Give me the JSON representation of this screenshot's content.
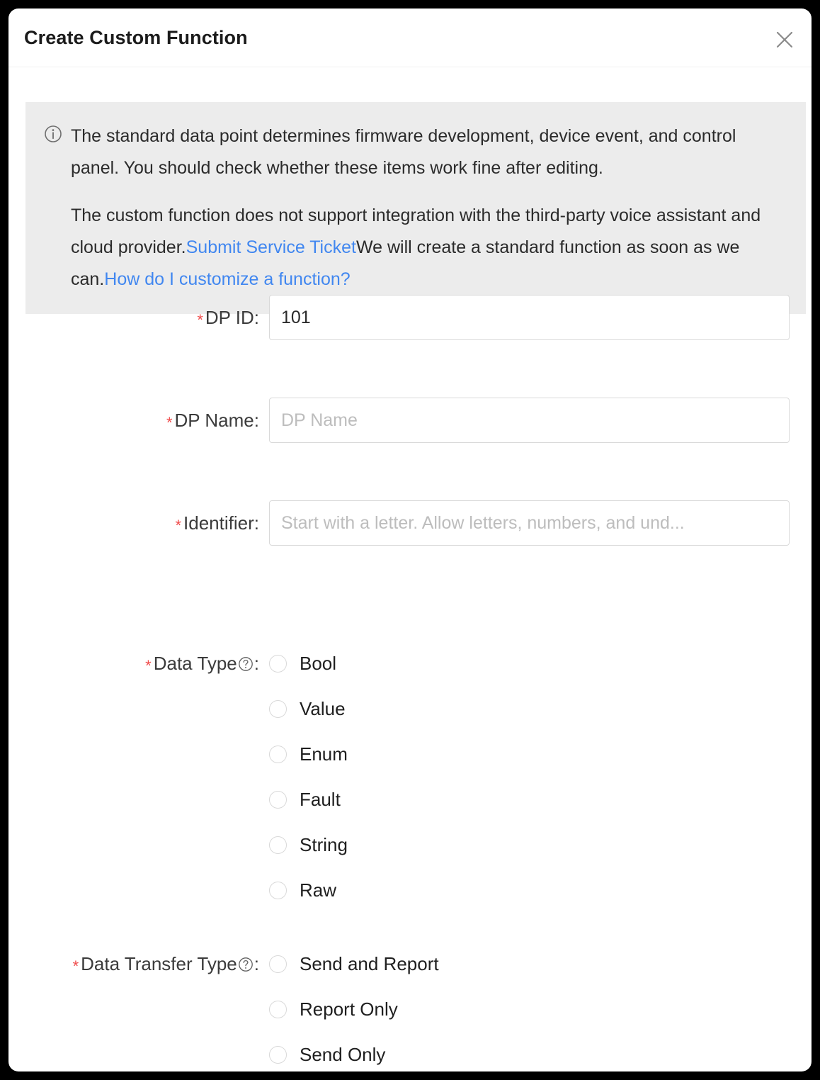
{
  "dialog": {
    "title": "Create Custom Function",
    "close_icon": "close-icon"
  },
  "info_banner": {
    "icon": "info-circle-icon",
    "paragraph_1": "The standard data point determines firmware development, device event, and control panel. You should check whether these items work fine after editing.",
    "paragraph_2_part_1": "The custom function does not support integration with the third-party voice assistant and cloud provider.",
    "link_1": "Submit Service Ticket",
    "paragraph_2_part_2": "We will create a standard function as soon as we can.",
    "link_2": "How do I customize a function?",
    "link_color": "#4187f0",
    "background_color": "#ececec"
  },
  "form": {
    "required_marker": "*",
    "help_icon": "question-circle-icon",
    "dp_id": {
      "label": "DP ID",
      "colon": ":",
      "value": "101",
      "placeholder": ""
    },
    "dp_name": {
      "label": "DP Name",
      "colon": ":",
      "value": "",
      "placeholder": "DP Name"
    },
    "identifier": {
      "label": "Identifier",
      "colon": ":",
      "value": "",
      "placeholder": "Start with a letter. Allow letters, numbers, and und..."
    },
    "data_type": {
      "label": "Data Type",
      "colon": ":",
      "selected": "",
      "options": [
        {
          "label": "Bool",
          "checked": false
        },
        {
          "label": "Value",
          "checked": false
        },
        {
          "label": "Enum",
          "checked": false
        },
        {
          "label": "Fault",
          "checked": false
        },
        {
          "label": "String",
          "checked": false
        },
        {
          "label": "Raw",
          "checked": false
        }
      ]
    },
    "data_transfer_type": {
      "label": "Data Transfer Type",
      "colon": ":",
      "selected": "",
      "options": [
        {
          "label": "Send and Report",
          "checked": false
        },
        {
          "label": "Report Only",
          "checked": false
        },
        {
          "label": "Send Only",
          "checked": false
        }
      ]
    }
  },
  "colors": {
    "required_star": "#f04b4b",
    "link": "#4187f0",
    "banner_bg": "#ececec",
    "border": "#d9d9d9",
    "text": "#1f1f1f"
  }
}
